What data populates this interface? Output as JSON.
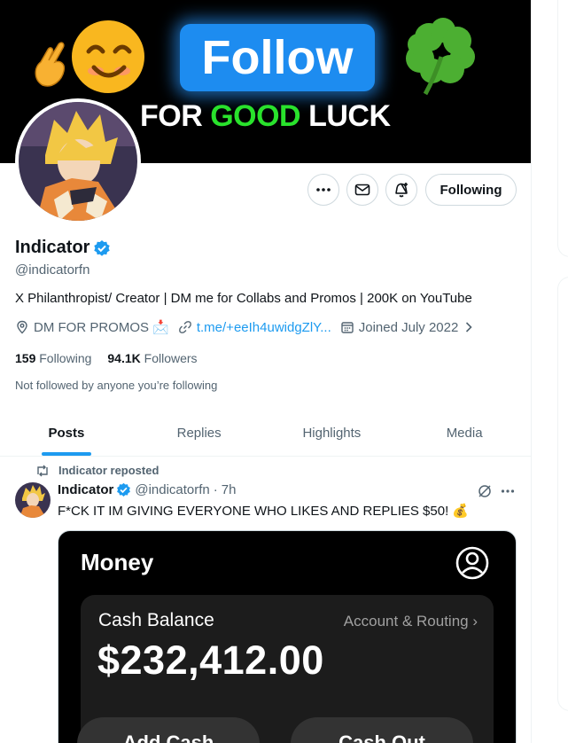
{
  "banner": {
    "follow_text": "Follow",
    "sub_for": "FOR ",
    "sub_good": "GOOD",
    "sub_luck": " LUCK"
  },
  "profile": {
    "display_name": "Indicator",
    "handle": "@indicatorfn",
    "bio": "X Philanthropist/ Creator | DM me for Collabs and Promos | 200K on YouTube",
    "location": "DM FOR PROMOS 📩",
    "link": "t.me/+eeIh4uwidgZlY...",
    "joined": "Joined July 2022",
    "following_count": "159",
    "following_label": "Following",
    "followers_count": "94.1K",
    "followers_label": "Followers",
    "not_followed_text": "Not followed by anyone you’re following",
    "follow_button_label": "Following"
  },
  "tabs": [
    {
      "label": "Posts"
    },
    {
      "label": "Replies"
    },
    {
      "label": "Highlights"
    },
    {
      "label": "Media"
    }
  ],
  "post": {
    "repost_label": "Indicator reposted",
    "author_name": "Indicator",
    "author_handle": "@indicatorfn",
    "separator": "·",
    "time": "7h",
    "text": "F*CK IT IM GIVING EVERYONE WHO LIKES AND REPLIES $50! 💰",
    "media": {
      "title": "Money",
      "balance_label": "Cash Balance",
      "routing_label": "Account & Routing  ›",
      "balance_amount": "$232,412.00",
      "add_cash_label": "Add Cash",
      "cash_out_label": "Cash Out"
    }
  },
  "colors": {
    "accent": "#1d9bf0",
    "muted_text": "#536471",
    "verified": "#1d9bf0"
  }
}
